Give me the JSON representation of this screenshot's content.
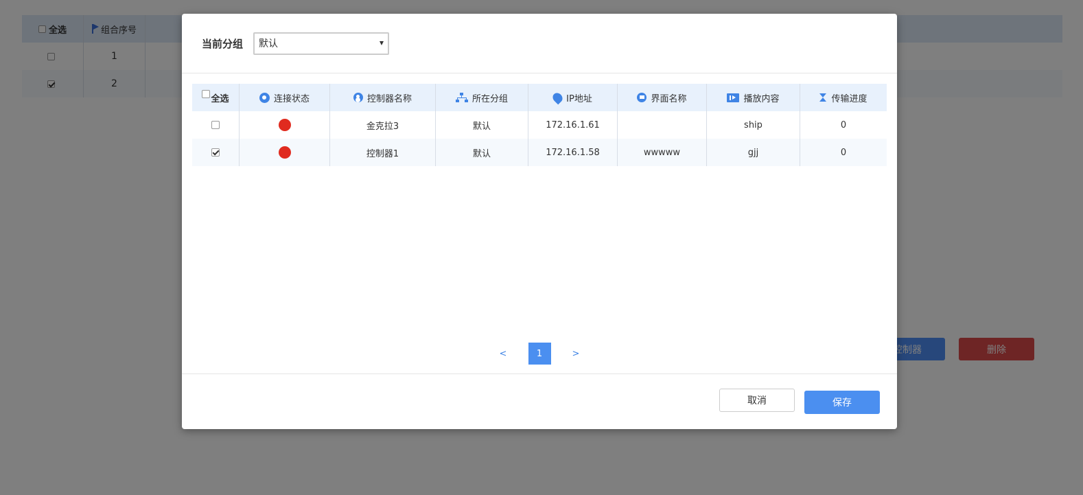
{
  "background": {
    "table": {
      "header": {
        "select_all": "全选",
        "seq": "组合序号"
      },
      "rows": [
        {
          "seq": "1",
          "checked": false
        },
        {
          "seq": "2",
          "checked": true
        }
      ]
    },
    "buttons": {
      "controller_partial": "控制器",
      "delete": "删除"
    }
  },
  "modal": {
    "group_label": "当前分组",
    "group_select_value": "默认",
    "table": {
      "headers": {
        "select_all": "全选",
        "status": "连接状态",
        "name": "控制器名称",
        "group": "所在分组",
        "ip": "IP地址",
        "screen": "界面名称",
        "content": "播放内容",
        "progress": "传输进度"
      },
      "rows": [
        {
          "checked": false,
          "status": "offline",
          "name": "金克拉3",
          "group": "默认",
          "ip": "172.16.1.61",
          "screen": "",
          "content": "ship",
          "progress": "0"
        },
        {
          "checked": true,
          "status": "offline",
          "name": "控制器1",
          "group": "默认",
          "ip": "172.16.1.58",
          "screen": "wwwww",
          "content": "gjj",
          "progress": "0"
        }
      ]
    },
    "pager": {
      "prev": "<",
      "current": "1",
      "next": ">"
    },
    "footer": {
      "cancel": "取消",
      "save": "保存"
    },
    "colors": {
      "accent": "#4b8ff0",
      "status_offline": "#e02b1f",
      "header_bg": "#e8f1fc"
    }
  }
}
